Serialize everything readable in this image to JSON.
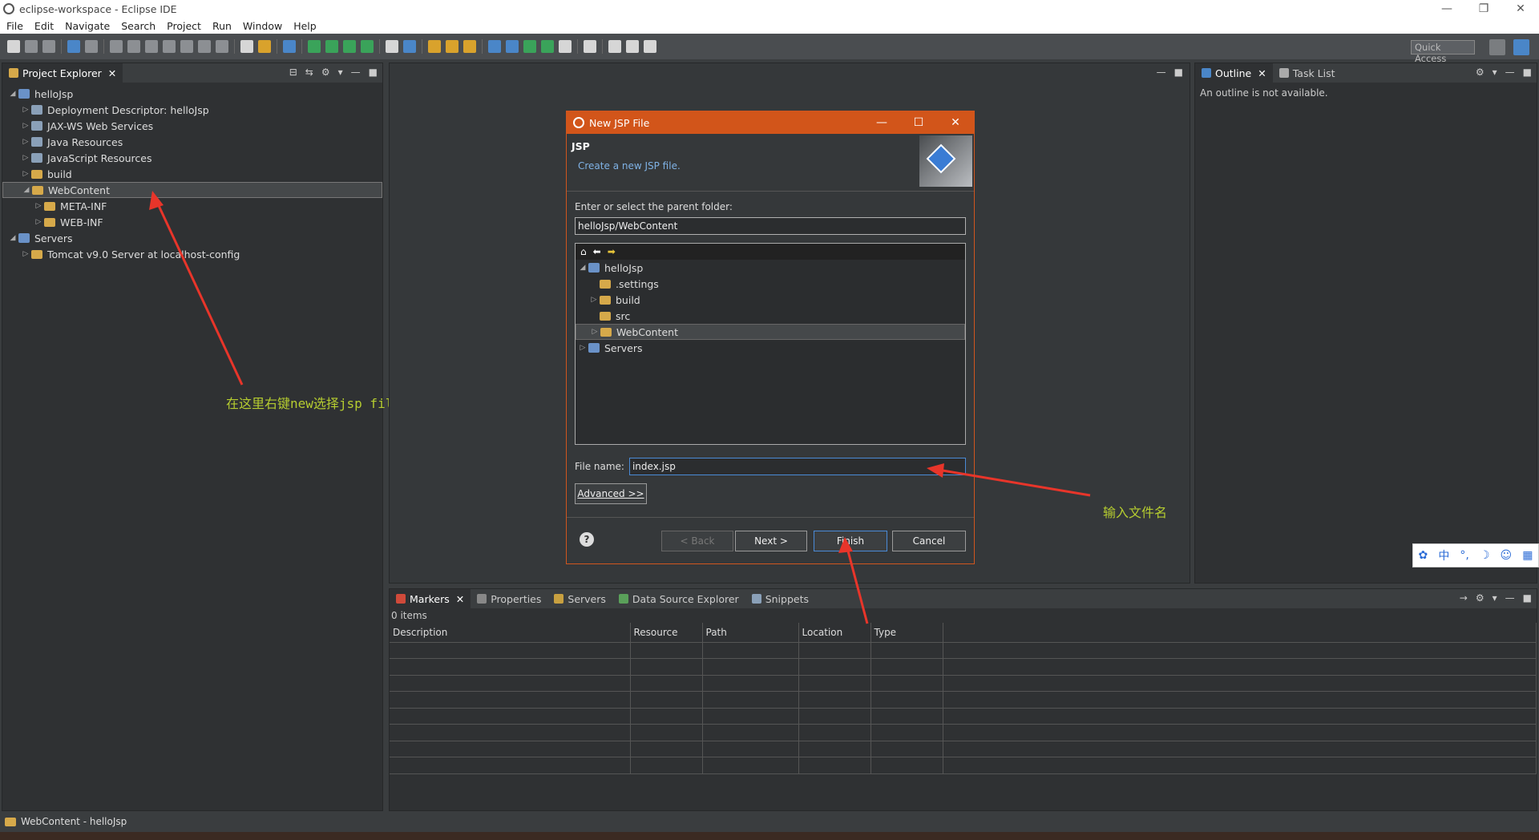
{
  "window": {
    "title": "eclipse-workspace - Eclipse IDE"
  },
  "menu": [
    "File",
    "Edit",
    "Navigate",
    "Search",
    "Project",
    "Run",
    "Window",
    "Help"
  ],
  "toolbar": {
    "quick_access": "Quick Access"
  },
  "project_explorer": {
    "tab_label": "Project Explorer",
    "items": [
      {
        "label": "helloJsp",
        "level": 0,
        "expanded": true,
        "icon": "project-icon"
      },
      {
        "label": "Deployment Descriptor: helloJsp",
        "level": 1,
        "icon": "descriptor-icon"
      },
      {
        "label": "JAX-WS Web Services",
        "level": 1,
        "icon": "webservice-icon"
      },
      {
        "label": "Java Resources",
        "level": 1,
        "icon": "java-resources-icon"
      },
      {
        "label": "JavaScript Resources",
        "level": 1,
        "icon": "js-resources-icon"
      },
      {
        "label": "build",
        "level": 1,
        "icon": "folder-icon"
      },
      {
        "label": "WebContent",
        "level": 1,
        "expanded": true,
        "selected": true,
        "icon": "folder-icon"
      },
      {
        "label": "META-INF",
        "level": 2,
        "icon": "folder-icon"
      },
      {
        "label": "WEB-INF",
        "level": 2,
        "icon": "folder-icon"
      },
      {
        "label": "Servers",
        "level": 0,
        "expanded": true,
        "icon": "project-icon"
      },
      {
        "label": "Tomcat v9.0 Server at localhost-config",
        "level": 1,
        "icon": "folder-icon"
      }
    ]
  },
  "annotations": {
    "right_click": "在这里右键new选择jsp file",
    "enter_filename": "输入文件名"
  },
  "outline": {
    "tab_label": "Outline",
    "task_list_label": "Task List",
    "empty_message": "An outline is not available."
  },
  "dialog": {
    "title": "New JSP File",
    "banner_title": "JSP",
    "banner_description": "Create a new JSP file.",
    "parent_folder_label": "Enter or select the parent folder:",
    "parent_folder_value": "helloJsp/WebContent",
    "tree": [
      {
        "label": "helloJsp",
        "level": 0,
        "expanded": true
      },
      {
        "label": ".settings",
        "level": 1
      },
      {
        "label": "build",
        "level": 1,
        "collapsible": true
      },
      {
        "label": "src",
        "level": 1
      },
      {
        "label": "WebContent",
        "level": 1,
        "collapsible": true,
        "selected": true
      },
      {
        "label": "Servers",
        "level": 0,
        "collapsible": true
      }
    ],
    "file_name_label": "File name:",
    "file_name_value": "index.jsp",
    "advanced_label": "Advanced >>",
    "back_label": "< Back",
    "next_label": "Next >",
    "finish_label": "Finish",
    "cancel_label": "Cancel"
  },
  "bottom_tabs": [
    "Markers",
    "Properties",
    "Servers",
    "Data Source Explorer",
    "Snippets"
  ],
  "markers": {
    "count_label": "0 items",
    "columns": [
      "Description",
      "Resource",
      "Path",
      "Location",
      "Type"
    ],
    "empty_rows": 8
  },
  "status": {
    "text": "WebContent - helloJsp"
  },
  "ime": [
    "中"
  ],
  "colors": {
    "accent": "#d2551a",
    "annotation": "#b5cc30",
    "arrow": "#e8352a"
  }
}
